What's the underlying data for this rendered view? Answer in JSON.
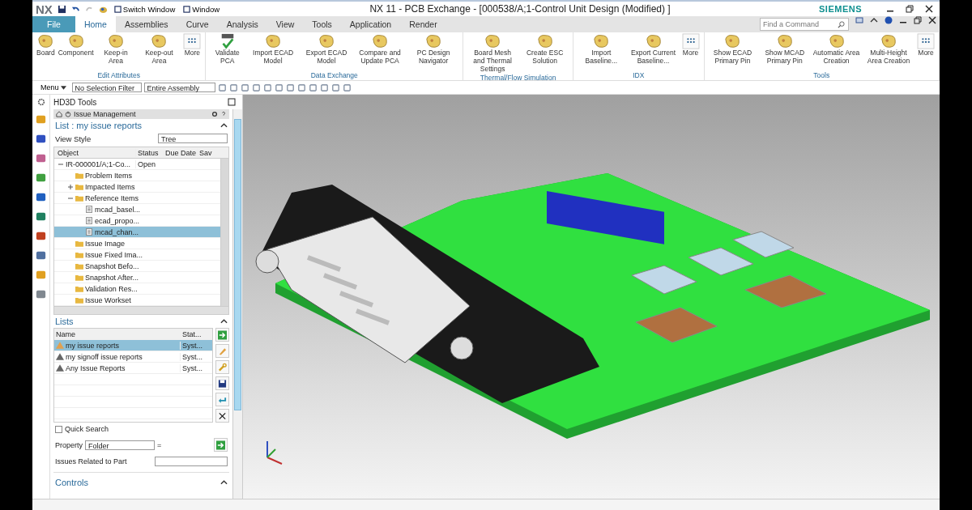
{
  "title_bar": {
    "logo": "NX",
    "quick_access": [
      {
        "label": "Switch Window"
      },
      {
        "label": "Window"
      }
    ],
    "title": "NX 11 - PCB Exchange - [000538/A;1-Control Unit Design (Modified) ]",
    "brand": "SIEMENS"
  },
  "menu_tabs": [
    {
      "label": "File",
      "kind": "file",
      "selected": false
    },
    {
      "label": "Home",
      "kind": "tab",
      "selected": true
    },
    {
      "label": "Assemblies",
      "kind": "tab",
      "selected": false
    },
    {
      "label": "Curve",
      "kind": "tab",
      "selected": false
    },
    {
      "label": "Analysis",
      "kind": "tab",
      "selected": false
    },
    {
      "label": "View",
      "kind": "tab",
      "selected": false
    },
    {
      "label": "Tools",
      "kind": "tab",
      "selected": false
    },
    {
      "label": "Application",
      "kind": "tab",
      "selected": false
    },
    {
      "label": "Render",
      "kind": "tab",
      "selected": false
    }
  ],
  "command_search": {
    "placeholder": "Find a Command"
  },
  "ribbon_groups": [
    {
      "label": "Edit Attributes",
      "buttons": [
        {
          "label": "Board"
        },
        {
          "label": "Component"
        },
        {
          "label": "Keep-in Area"
        },
        {
          "label": "Keep-out Area"
        },
        {
          "label": "More",
          "kind": "more"
        }
      ]
    },
    {
      "label": "Data Exchange",
      "buttons": [
        {
          "label": "Validate PCA",
          "kind": "pcb"
        },
        {
          "label": "Import ECAD Model"
        },
        {
          "label": "Export ECAD Model"
        },
        {
          "label": "Compare and Update PCA"
        },
        {
          "label": "PC Design Navigator"
        }
      ]
    },
    {
      "label": "Thermal/Flow Simulation",
      "buttons": [
        {
          "label": "Board Mesh and Thermal Settings"
        },
        {
          "label": "Create ESC Solution"
        }
      ]
    },
    {
      "label": "IDX",
      "buttons": [
        {
          "label": "Import Baseline..."
        },
        {
          "label": "Export Current Baseline..."
        },
        {
          "label": "More",
          "kind": "more"
        }
      ]
    },
    {
      "label": "Tools",
      "buttons": [
        {
          "label": "Show ECAD Primary Pin"
        },
        {
          "label": "Show MCAD Primary Pin"
        },
        {
          "label": "Automatic Area Creation"
        },
        {
          "label": "Multi-Height Area Creation"
        },
        {
          "label": "More",
          "kind": "more"
        }
      ]
    }
  ],
  "toolbar": {
    "menu": "Menu",
    "selection_filter": "No Selection Filter",
    "scope": "Entire Assembly"
  },
  "panel": {
    "title": "HD3D Tools",
    "header": "Issue Management",
    "list_title": "List : my issue reports",
    "view_style_label": "View Style",
    "view_style": "Tree",
    "tree_columns": [
      "Object",
      "Status",
      "Due Date",
      "Sav"
    ],
    "tree": [
      {
        "label": "IR-000001/A;1-Co...",
        "status": "Open",
        "expanded": true,
        "selected": false,
        "children": [
          {
            "label": "Problem Items",
            "kind": "folder",
            "selected": false
          },
          {
            "label": "Impacted Items",
            "kind": "folder",
            "expanded": false,
            "selected": false
          },
          {
            "label": "Reference Items",
            "kind": "folder",
            "expanded": true,
            "selected": false,
            "children": [
              {
                "label": "mcad_basel...",
                "kind": "file",
                "selected": false
              },
              {
                "label": "ecad_propo...",
                "kind": "file",
                "selected": false
              },
              {
                "label": "mcad_chan...",
                "kind": "file",
                "selected": true
              }
            ]
          },
          {
            "label": "Issue Image",
            "kind": "folder",
            "selected": false
          },
          {
            "label": "Issue Fixed Ima...",
            "kind": "folder",
            "selected": false
          },
          {
            "label": "Snapshot Befo...",
            "kind": "folder",
            "selected": false
          },
          {
            "label": "Snapshot After...",
            "kind": "folder",
            "selected": false
          },
          {
            "label": "Validation Res...",
            "kind": "folder",
            "selected": false
          },
          {
            "label": "Issue Workset",
            "kind": "folder",
            "selected": false
          }
        ]
      }
    ],
    "lists_title": "Lists",
    "list_columns": [
      "Name",
      "Stat..."
    ],
    "lists": [
      {
        "name": "my issue reports",
        "status": "Syst...",
        "selected": true
      },
      {
        "name": "my signoff issue reports",
        "status": "Syst...",
        "selected": false
      },
      {
        "name": "Any Issue Reports",
        "status": "Syst...",
        "selected": false
      }
    ],
    "quick_search": {
      "label": "Quick Search",
      "checked": false
    },
    "property": {
      "label": "Property",
      "value": "Folder",
      "operator": "="
    },
    "related_label": "Issues Related to Part",
    "controls_title": "Controls"
  }
}
